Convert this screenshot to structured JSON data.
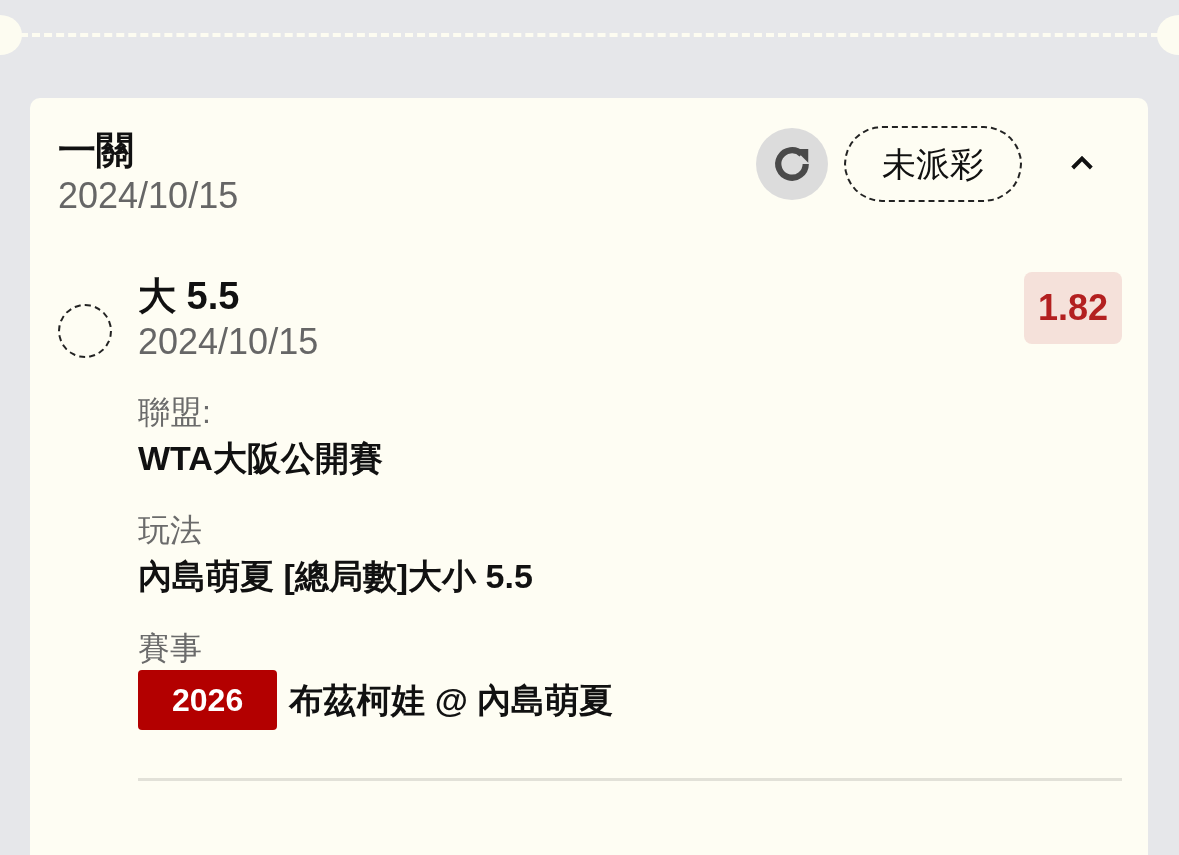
{
  "ticket": {
    "title": "一關",
    "date": "2024/10/15",
    "status": "未派彩",
    "expanded": true,
    "legs": [
      {
        "selection": "大 5.5",
        "date": "2024/10/15",
        "odds": "1.82",
        "selected": false,
        "details": [
          {
            "label": "聯盟:",
            "value": "WTA大阪公開賽"
          },
          {
            "label": "玩法",
            "value": "內島萌夏 [總局數]大小 5.5"
          }
        ],
        "event": {
          "label": "賽事",
          "code": "2026",
          "name": "布茲柯娃 @ 內島萌夏"
        }
      }
    ]
  }
}
